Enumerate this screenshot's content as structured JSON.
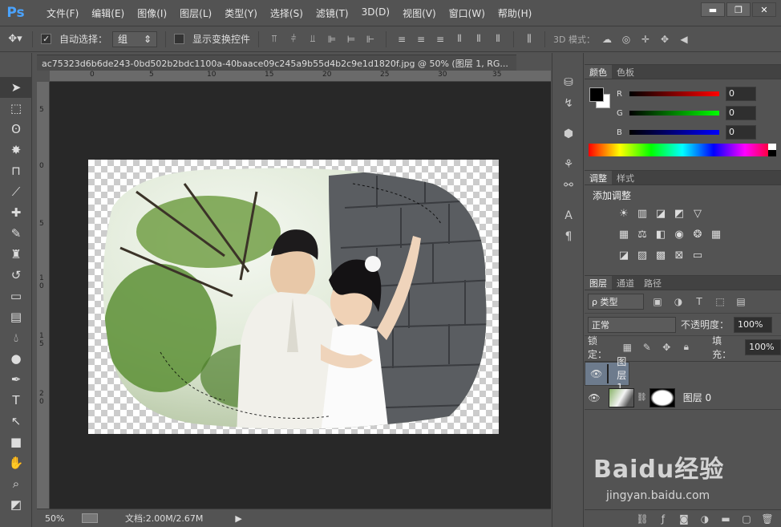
{
  "app": {
    "logo": "Ps"
  },
  "menu": [
    "文件(F)",
    "编辑(E)",
    "图像(I)",
    "图层(L)",
    "类型(Y)",
    "选择(S)",
    "滤镜(T)",
    "3D(D)",
    "视图(V)",
    "窗口(W)",
    "帮助(H)"
  ],
  "window_controls": {
    "minimize": "▬",
    "restore": "❐",
    "close": "✕"
  },
  "options": {
    "auto_select_label": "自动选择：",
    "auto_select_value": "组",
    "show_transform_label": "显示变换控件",
    "mode_3d_label": "3D 模式："
  },
  "document": {
    "tab_title": "ac75323d6b6de243-0bd502b2bdc1100a-40baace09c245a9b55d4b2c9e1d1820f.jpg @ 50% (图层 1, RG...",
    "tab_close": "×",
    "ruler_h": [
      "0",
      "5",
      "10",
      "15",
      "20",
      "25",
      "30",
      "35"
    ],
    "ruler_v": [
      "5",
      "0",
      "5",
      "1 0",
      "1 5",
      "2 0"
    ]
  },
  "status": {
    "zoom": "50%",
    "doc_info": "文档:2.00M/2.67M"
  },
  "color_panel": {
    "tabs": [
      "颜色",
      "色板"
    ],
    "channels": [
      {
        "label": "R",
        "value": "0",
        "color": "#ff0000"
      },
      {
        "label": "G",
        "value": "0",
        "color": "#00ff00"
      },
      {
        "label": "B",
        "value": "0",
        "color": "#0000ff"
      }
    ]
  },
  "adjust_panel": {
    "tabs": [
      "调整",
      "样式"
    ],
    "title": "添加调整"
  },
  "layers_panel": {
    "tabs": [
      "图层",
      "通道",
      "路径"
    ],
    "filter_label": "ρ 类型",
    "blend_mode": "正常",
    "opacity_label": "不透明度：",
    "opacity_value": "100%",
    "lock_label": "锁定：",
    "fill_label": "填充：",
    "fill_value": "100%",
    "layers": [
      {
        "name": "图层 1",
        "selected": true
      },
      {
        "name": "图层 0",
        "selected": false
      }
    ]
  },
  "watermark": {
    "brand": "Baidu经验",
    "url": "jingyan.baidu.com"
  }
}
